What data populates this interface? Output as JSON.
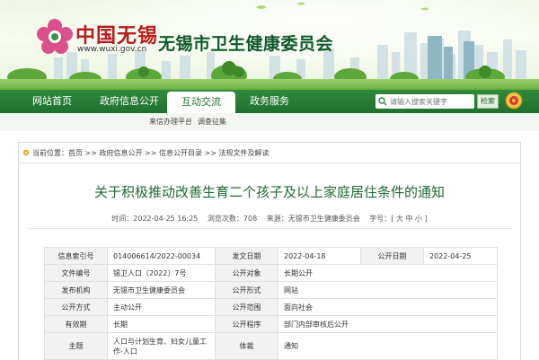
{
  "header": {
    "logo_text": "中国无锡",
    "logo_url": "www.wuxi.gov.cn",
    "site_title": "无锡市卫生健康委员会"
  },
  "nav": {
    "items": [
      {
        "label": "网站首页"
      },
      {
        "label": "政府信息公开"
      },
      {
        "label": "互动交流",
        "active": true
      },
      {
        "label": "政务服务"
      }
    ],
    "search_placeholder": "请输入搜索关键字",
    "search_button": "检索"
  },
  "subnav": {
    "items": [
      {
        "label": "来信办理平台"
      },
      {
        "label": "调查征集"
      }
    ]
  },
  "breadcrumb": {
    "prefix": "当前位置：",
    "items": [
      "首页",
      "政府信息公开",
      "信息公开目录",
      "法规文件及解读"
    ],
    "separator": " >> "
  },
  "document": {
    "title": "关于积极推动改善生育二个孩子及以上家庭居住条件的通知",
    "meta": {
      "time": "时间：2022-04-25 16:25",
      "views": "浏览次数：708",
      "source": "来源：无锡市卫生健康委员会",
      "font_size": "字号：[ 大 中 小 ]"
    }
  },
  "info_table": {
    "rows": [
      [
        "信息索引号",
        "014006614/2022-00034",
        "发文日期",
        "2022-04-18",
        "公开日期",
        "2022-04-25"
      ],
      [
        "文件编号",
        "锡卫人口〔2022〕7号",
        "公开对象",
        "长期公开"
      ],
      [
        "发布机构",
        "无锡市卫生健康委员会",
        "公开形式",
        "网站"
      ],
      [
        "公开方式",
        "主动公开",
        "公开范围",
        "面向社会"
      ],
      [
        "有效期",
        "长期",
        "公开程序",
        "部门内部审核后公开"
      ],
      [
        "主题",
        "人口与计划生育、妇女儿童工作-人口",
        "体裁",
        "通知"
      ]
    ]
  },
  "colors": {
    "nav_green": "#1f6f2e",
    "title_green": "#1e6a33",
    "logo_red": "#b61c1c"
  }
}
